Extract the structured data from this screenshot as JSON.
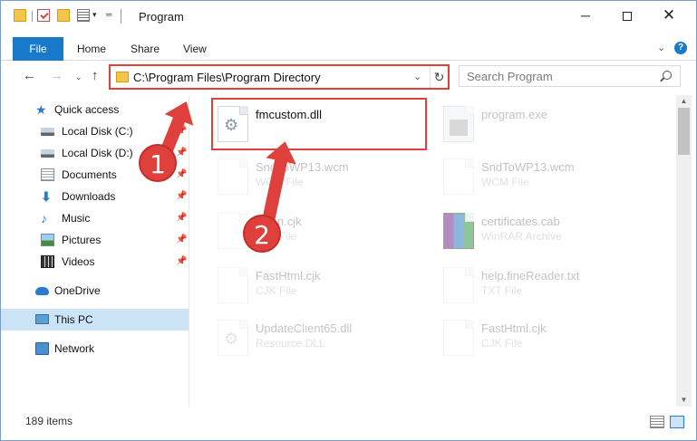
{
  "window": {
    "title": "Program",
    "controls": {
      "minimize": "─",
      "close": "✕"
    }
  },
  "quick_access_toolbar": {
    "dropdown_glyph": "▾",
    "customize_glyph": "═"
  },
  "ribbon": {
    "tabs": [
      "File",
      "Home",
      "Share",
      "View"
    ],
    "expand_glyph": "⌄",
    "help_glyph": "?"
  },
  "nav": {
    "back": "←",
    "forward": "→",
    "recent": "⌄",
    "up": "↑"
  },
  "address": {
    "path": "C:\\Program Files\\Program Directory",
    "dropdown": "⌄",
    "refresh": "↻"
  },
  "search": {
    "placeholder": "Search Program"
  },
  "sidebar": {
    "quick_access": "Quick access",
    "items": [
      {
        "label": "Local Disk (C:)",
        "pinned": true
      },
      {
        "label": "Local Disk (D:)",
        "pinned": true
      },
      {
        "label": "Documents",
        "pinned": true
      },
      {
        "label": "Downloads",
        "pinned": true
      },
      {
        "label": "Music",
        "pinned": true
      },
      {
        "label": "Pictures",
        "pinned": true
      },
      {
        "label": "Videos",
        "pinned": true
      }
    ],
    "pin_glyph": "📌",
    "onedrive": "OneDrive",
    "this_pc": "This PC",
    "network": "Network"
  },
  "files": [
    {
      "name": "fmcustom.dll",
      "type": ""
    },
    {
      "name": "program.exe",
      "type": ""
    },
    {
      "name": "SndToWP13.wcm",
      "type": "WCM File"
    },
    {
      "name": "SndToWP13.wcm",
      "type": "WCM File"
    },
    {
      "name": "clean.cjk",
      "type": "CJK File"
    },
    {
      "name": "certificates.cab",
      "type": "WinRAR Archive"
    },
    {
      "name": "FastHtml.cjk",
      "type": "CJK File"
    },
    {
      "name": "help.fineReader.txt",
      "type": "TXT File"
    },
    {
      "name": "UpdateClient65.dll",
      "type": "Resource DLL"
    },
    {
      "name": "FastHtml.cjk",
      "type": "CJK File"
    }
  ],
  "status": {
    "item_count": "189 items"
  },
  "scrollbar": {
    "up": "▲",
    "down": "▼"
  },
  "annotations": {
    "step1": "1",
    "step2": "2"
  },
  "colors": {
    "accent": "#1979ca",
    "highlight": "#e0403c",
    "selected": "#cce4f7"
  }
}
